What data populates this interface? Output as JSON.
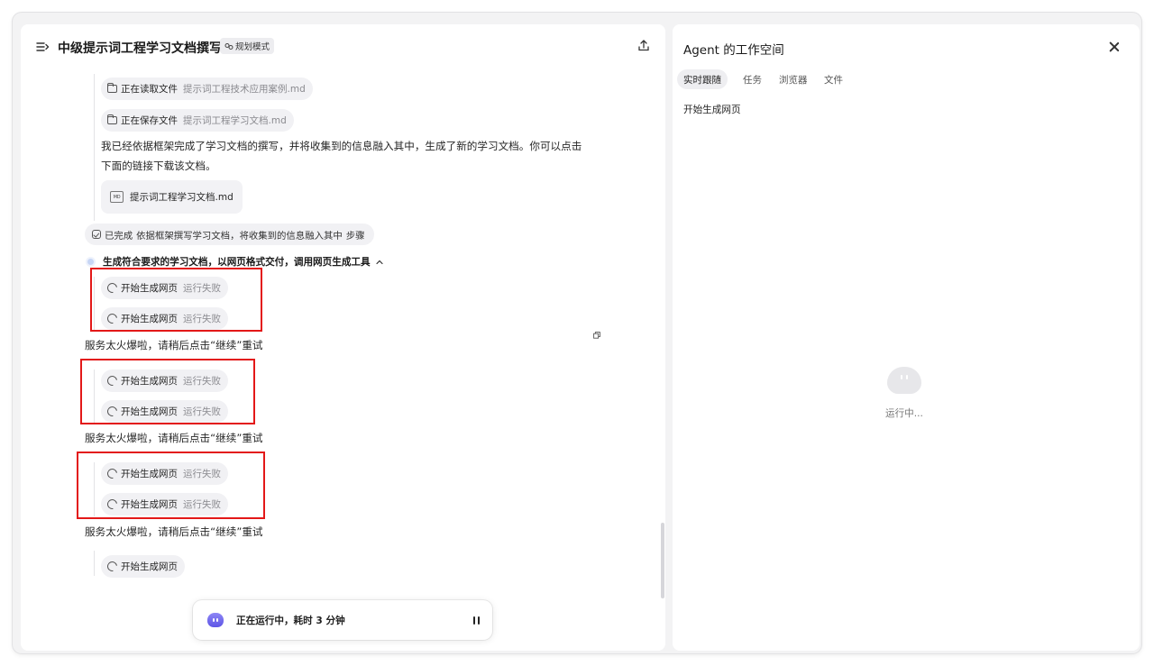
{
  "chat": {
    "title": "中级提示词工程学习文档撰写",
    "mode_badge": "规划模式",
    "read_file": {
      "action": "正在读取文件",
      "file": "提示词工程技术应用案例.md"
    },
    "save_file": {
      "action": "正在保存文件",
      "file": "提示词工程学习文档.md"
    },
    "message_line1": "我已经依据框架完成了学习文档的撰写，并将收集到的信息融入其中，生成了新的学习文档。你可以点击",
    "message_line2": "下面的链接下载该文档。",
    "attachment": {
      "icon_text": "MD",
      "name": "提示词工程学习文档.md"
    },
    "completed_step": {
      "status": "已完成",
      "text": "依据框架撰写学习文档，将收集到的信息融入其中",
      "suffix": "步骤"
    },
    "current_step": "生成符合要求的学习文档，以网页格式交付，调用网页生成工具",
    "tool_action": "开始生成网页",
    "tool_failed": "运行失败",
    "error_message": "服务太火爆啦，请稍后点击“继续”重试",
    "running_status": "正在运行中，耗时 3 分钟"
  },
  "workspace": {
    "title": "Agent 的工作空间",
    "tabs": [
      "实时跟随",
      "任务",
      "浏览器",
      "文件"
    ],
    "current_action": "开始生成网页",
    "status": "运行中..."
  },
  "colors": {
    "highlight_box": "#e31818",
    "accent": "#5e55e6",
    "pill_bg": "#f1f1f4"
  }
}
